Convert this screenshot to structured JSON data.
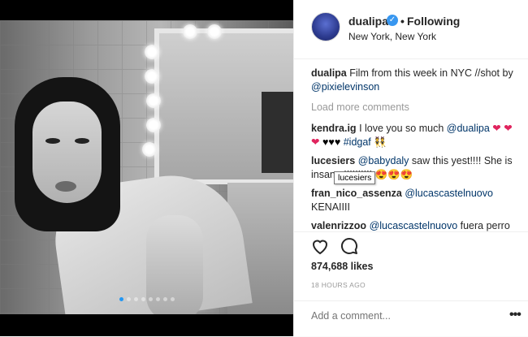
{
  "post": {
    "username": "dualipa",
    "separator": "•",
    "following_label": "Following",
    "location": "New York, New York"
  },
  "caption": {
    "username": "dualipa",
    "text_before": "Film from this week in NYC //shot by ",
    "mention": "@pixielevinson"
  },
  "load_more_label": "Load more comments",
  "comments": [
    {
      "username": "kendra.ig",
      "text_before": "I love you so much ",
      "mention": "@dualipa",
      "emoji_red": "❤ ❤❤",
      "emoji_black": "♥♥♥",
      "hashtag": "#idgaf"
    },
    {
      "username": "lucesiers",
      "mention": "@babydaly",
      "text": " saw this yest!!!! She is insane !!!!!!!!!! ",
      "emojis": "😍😍😍"
    },
    {
      "username": "fran_nico_assenza",
      "mention": "@lucascastelnuovo",
      "text": "KENAIIII"
    },
    {
      "username": "valenrizzoo",
      "mention": "@lucascastelnuovo",
      "text": " fuera perro"
    }
  ],
  "tooltip": "lucesiers",
  "likes": "874,688 likes",
  "timestamp": "18 HOURS AGO",
  "add_comment_placeholder": "Add a comment...",
  "more_label": "•••",
  "icons": {
    "verified": "verified-badge-icon",
    "heart": "heart-icon",
    "comment": "comment-icon",
    "more": "more-options-icon"
  },
  "colors": {
    "link": "#003569",
    "muted": "#999999",
    "verified": "#3897f0",
    "carousel_active": "#2196f3"
  },
  "carousel": {
    "count": 8,
    "active_index": 0
  }
}
